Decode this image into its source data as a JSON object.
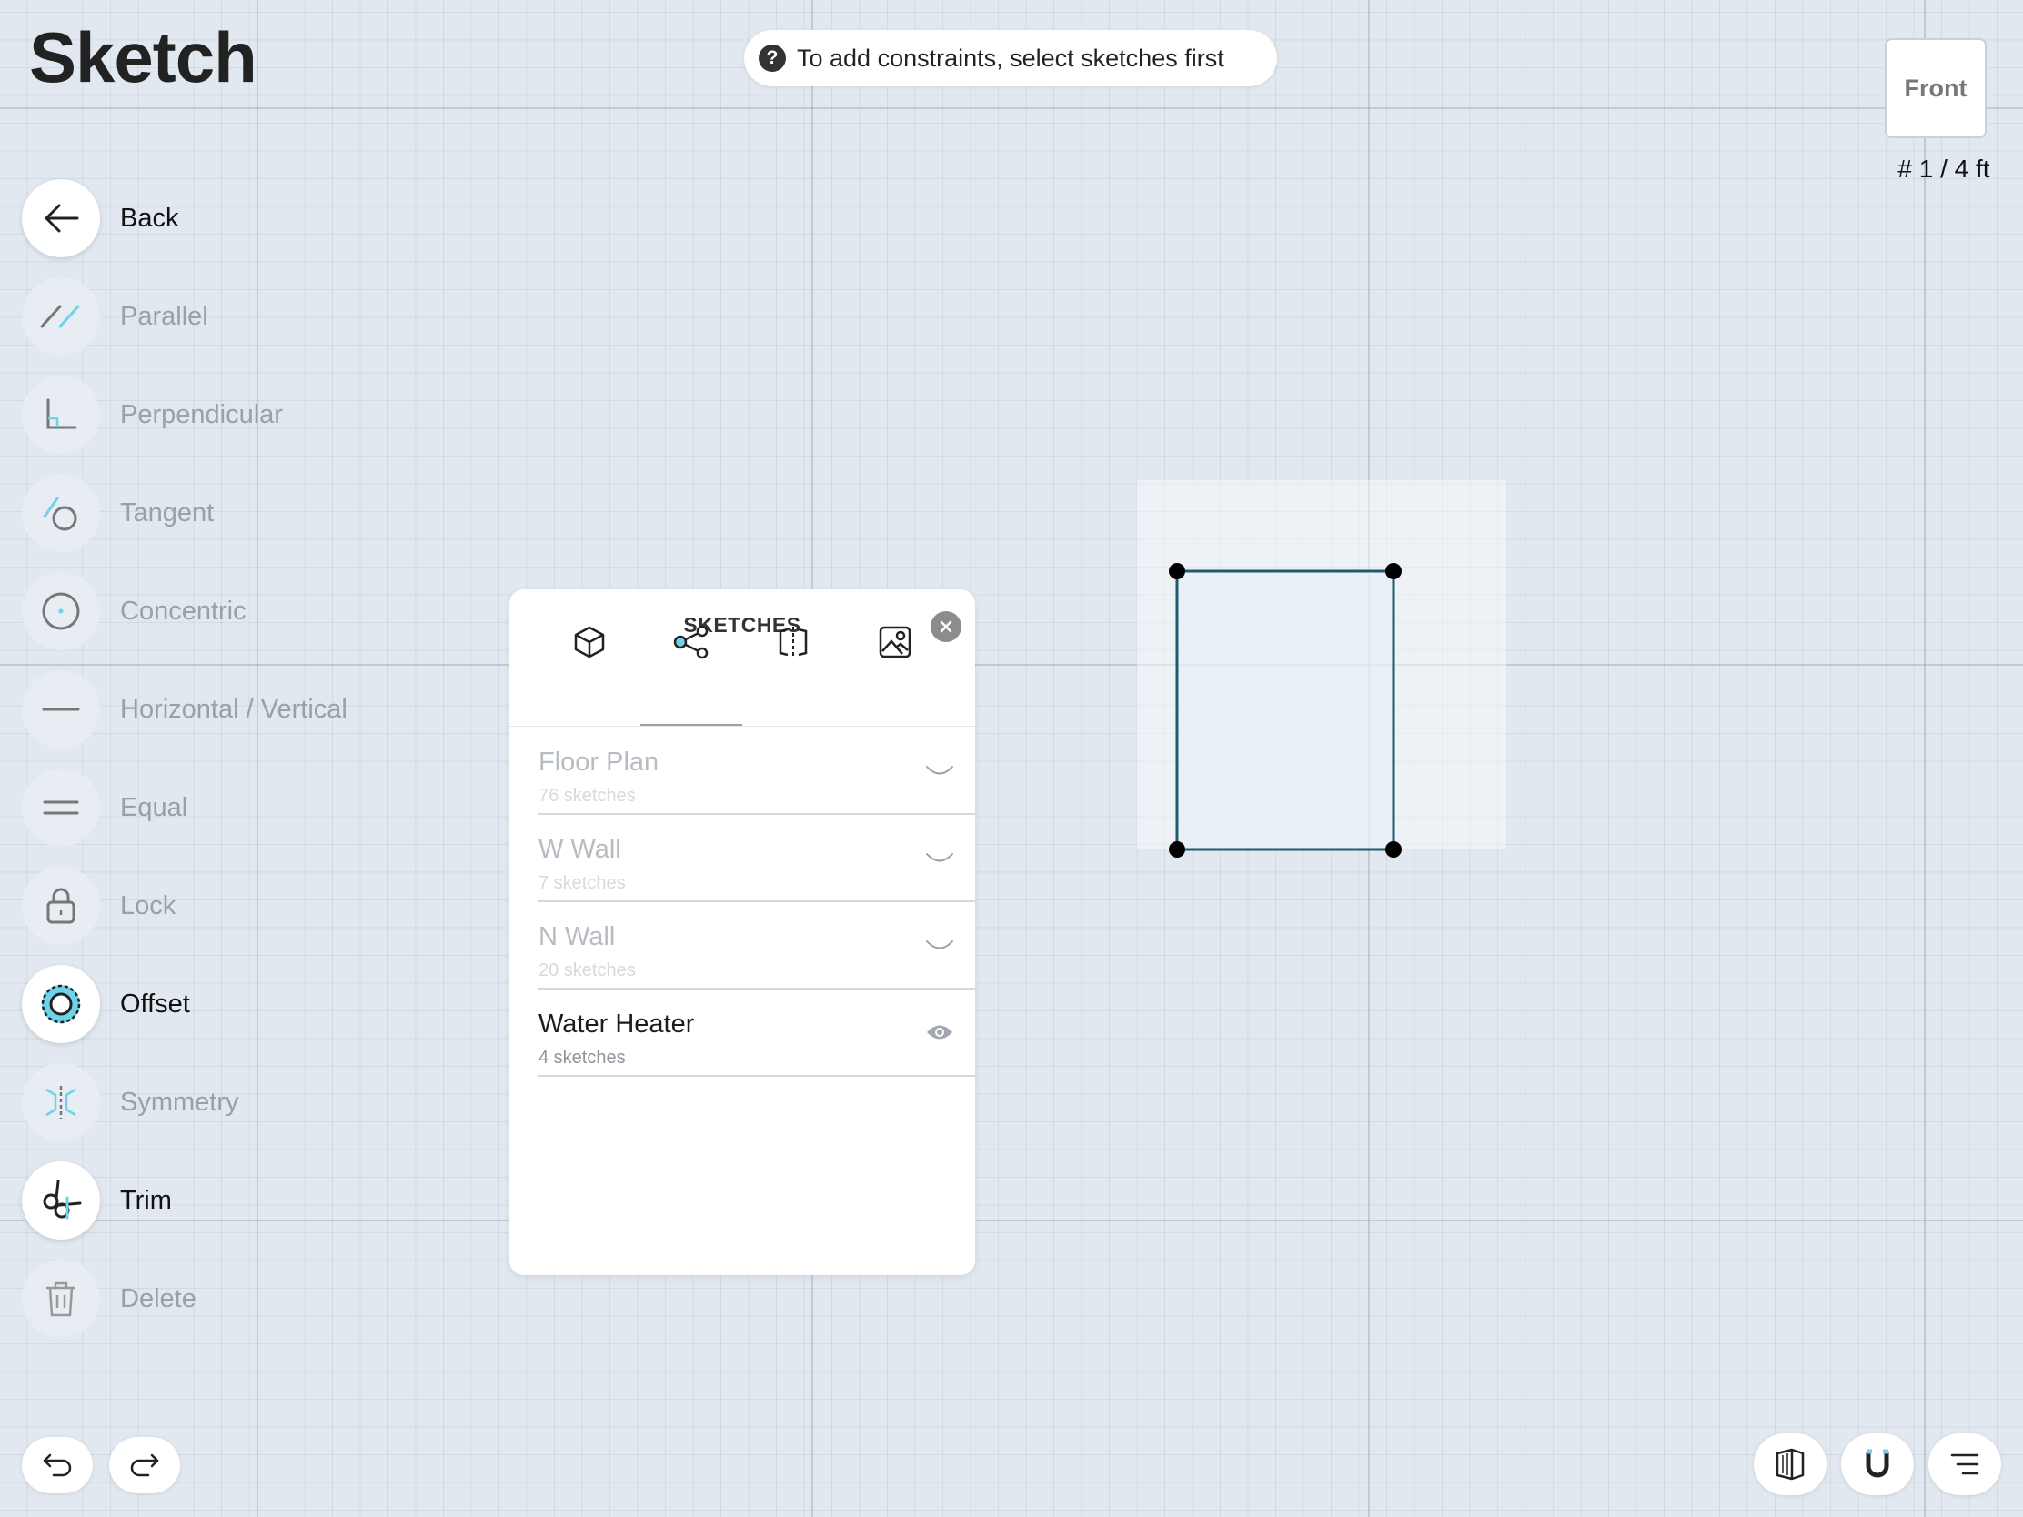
{
  "app": {
    "title": "Sketch"
  },
  "hint": {
    "text": "To add constraints, select sketches first",
    "icon": "question-icon"
  },
  "view": {
    "label": "Front",
    "scale": "# 1 / 4 ft"
  },
  "tools": [
    {
      "label": "Back",
      "icon": "arrow-left-icon",
      "enabled": true
    },
    {
      "label": "Parallel",
      "icon": "parallel-icon",
      "enabled": false
    },
    {
      "label": "Perpendicular",
      "icon": "perpendicular-icon",
      "enabled": false
    },
    {
      "label": "Tangent",
      "icon": "tangent-icon",
      "enabled": false
    },
    {
      "label": "Concentric",
      "icon": "concentric-icon",
      "enabled": false
    },
    {
      "label": "Horizontal / Vertical",
      "icon": "horizontal-vertical-icon",
      "enabled": false
    },
    {
      "label": "Equal",
      "icon": "equal-icon",
      "enabled": false
    },
    {
      "label": "Lock",
      "icon": "lock-icon",
      "enabled": false
    },
    {
      "label": "Offset",
      "icon": "offset-icon",
      "enabled": true
    },
    {
      "label": "Symmetry",
      "icon": "symmetry-icon",
      "enabled": false
    },
    {
      "label": "Trim",
      "icon": "trim-icon",
      "enabled": true
    },
    {
      "label": "Delete",
      "icon": "trash-icon",
      "enabled": false
    }
  ],
  "panel": {
    "title": "SKETCHES",
    "tabs": [
      {
        "icon": "cube-icon",
        "active": false
      },
      {
        "icon": "nodes-icon",
        "active": true
      },
      {
        "icon": "mirror-icon",
        "active": false
      },
      {
        "icon": "image-icon",
        "active": false
      }
    ],
    "rows": [
      {
        "name": "Floor Plan",
        "count": "76 sketches",
        "status": "hidden"
      },
      {
        "name": "W Wall",
        "count": "7 sketches",
        "status": "hidden"
      },
      {
        "name": "N Wall",
        "count": "20 sketches",
        "status": "hidden"
      },
      {
        "name": "Water Heater",
        "count": "4 sketches",
        "status": "visible"
      }
    ]
  },
  "colors": {
    "accent": "#6ed3ea",
    "sketch_stroke": "#1f5a6e",
    "canvas": "#e1e8ef"
  }
}
